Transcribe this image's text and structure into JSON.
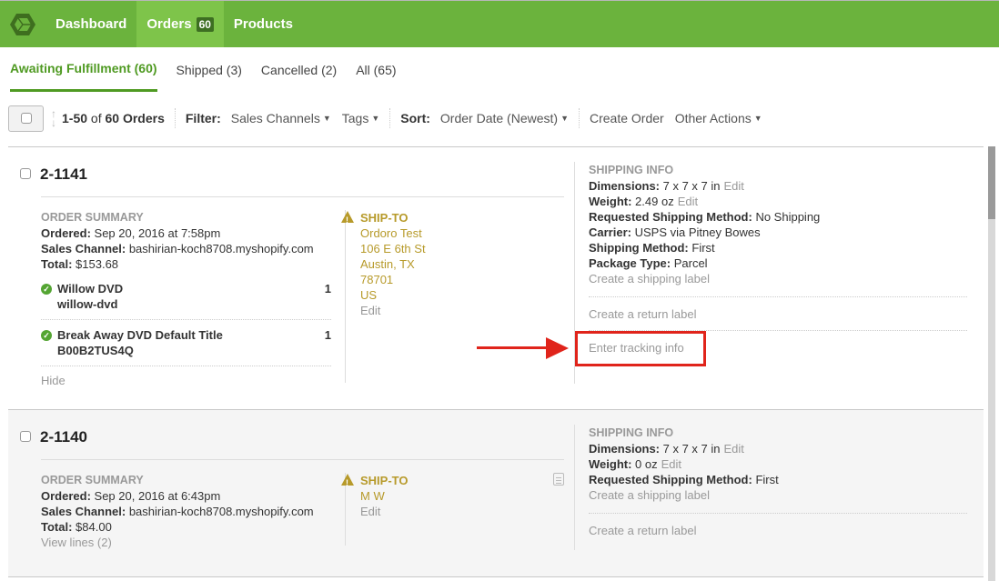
{
  "nav": {
    "items": [
      {
        "label": "Dashboard"
      },
      {
        "label": "Orders",
        "badge": "60"
      },
      {
        "label": "Products"
      }
    ]
  },
  "tabs": [
    {
      "label": "Awaiting Fulfillment (60)"
    },
    {
      "label": "Shipped (3)"
    },
    {
      "label": "Cancelled (2)"
    },
    {
      "label": "All (65)"
    }
  ],
  "toolbar": {
    "range": "1-50",
    "of": " of ",
    "total": "60 Orders",
    "filter_label": "Filter:",
    "sales_channels": "Sales Channels",
    "tags": "Tags",
    "sort_label": "Sort:",
    "sort_value": "Order Date (Newest)",
    "create_order": "Create Order",
    "other_actions": "Other Actions"
  },
  "orders": [
    {
      "number": "2-1141",
      "summary_title": "ORDER SUMMARY",
      "ordered_label": "Ordered:",
      "ordered": "Sep 20, 2016 at 7:58pm",
      "channel_label": "Sales Channel:",
      "channel": "bashirian-koch8708.myshopify.com",
      "total_label": "Total:",
      "total": "$153.68",
      "lines": [
        {
          "name": "Willow DVD",
          "sku": "willow-dvd",
          "qty": "1"
        },
        {
          "name": "Break Away DVD Default Title",
          "sku": "B00B2TUS4Q",
          "qty": "1"
        }
      ],
      "hide": "Hide",
      "shipto_title": "SHIP-TO",
      "address": [
        "Ordoro Test",
        "106 E 6th St",
        "Austin, TX",
        "78701",
        "US"
      ],
      "edit": "Edit",
      "shipping": {
        "title": "SHIPPING INFO",
        "dimensions_label": "Dimensions:",
        "dimensions": "7 x 7 x 7 in",
        "weight_label": "Weight:",
        "weight": "2.49 oz",
        "edit": "Edit",
        "requested_label": "Requested Shipping Method:",
        "requested": "No Shipping",
        "carrier_label": "Carrier:",
        "carrier": "USPS via Pitney Bowes",
        "method_label": "Shipping Method:",
        "method": "First",
        "package_label": "Package Type:",
        "package": "Parcel",
        "create_label": "Create a shipping label",
        "return_label": "Create a return label",
        "tracking": "Enter tracking info"
      }
    },
    {
      "number": "2-1140",
      "summary_title": "ORDER SUMMARY",
      "ordered_label": "Ordered:",
      "ordered": "Sep 20, 2016 at 6:43pm",
      "channel_label": "Sales Channel:",
      "channel": "bashirian-koch8708.myshopify.com",
      "total_label": "Total:",
      "total": "$84.00",
      "view_lines": "View lines (2)",
      "shipto_title": "SHIP-TO",
      "address": [
        "M W"
      ],
      "edit": "Edit",
      "shipping": {
        "title": "SHIPPING INFO",
        "dimensions_label": "Dimensions:",
        "dimensions": "7 x 7 x 7 in",
        "weight_label": "Weight:",
        "weight": "0 oz",
        "edit": "Edit",
        "requested_label": "Requested Shipping Method:",
        "requested": "First",
        "create_label": "Create a shipping label",
        "return_label": "Create a return label"
      }
    }
  ],
  "annotation": {
    "highlight_color": "#e0241b"
  }
}
